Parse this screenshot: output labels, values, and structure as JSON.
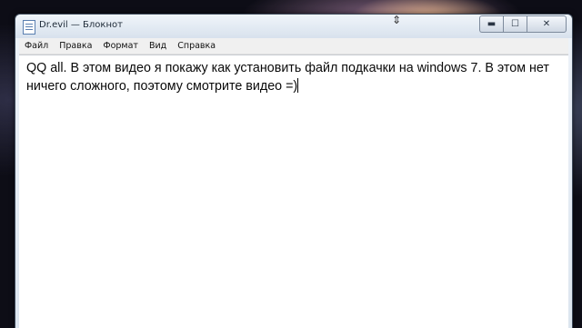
{
  "window": {
    "title": "Dr.evil — Блокнот",
    "icon": "notepad-icon",
    "controls": {
      "minimize": "▬",
      "maximize": "☐",
      "close": "✕"
    }
  },
  "menu": {
    "items": [
      "Файл",
      "Правка",
      "Формат",
      "Вид",
      "Справка"
    ]
  },
  "editor": {
    "content": "QQ all. В этом видео я покажу как установить файл подкачки на windows 7. В этом нет ничего сложного, поэтому смотрите видео =)"
  },
  "cursor": {
    "icon": "resize-vertical-icon",
    "glyph": "⇕"
  }
}
